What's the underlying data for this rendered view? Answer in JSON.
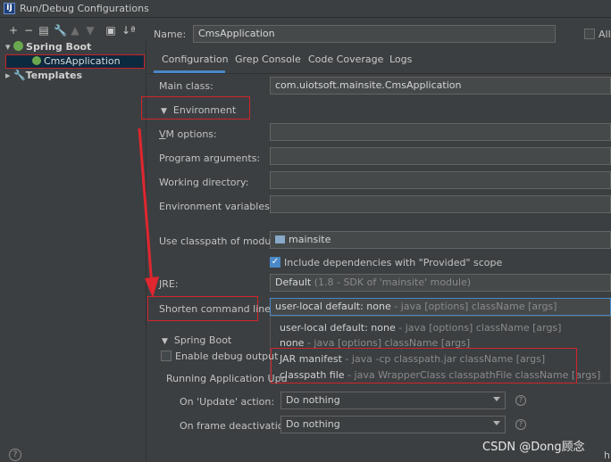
{
  "window": {
    "title": "Run/Debug Configurations",
    "app_icon": "IJ"
  },
  "toolbar": {
    "icons": [
      "plus-icon",
      "minus-icon",
      "copy-icon",
      "wrench-icon",
      "up-icon",
      "down-icon",
      "folder-icon",
      "sort-icon"
    ]
  },
  "tree": {
    "groups": [
      {
        "label": "Spring Boot",
        "children": [
          {
            "label": "CmsApplication"
          }
        ]
      },
      {
        "label": "Templates"
      }
    ]
  },
  "header": {
    "name_label": "Name:",
    "name_value": "CmsApplication",
    "allow_label": "Allo"
  },
  "tabs": [
    "Configuration",
    "Grep Console",
    "Code Coverage",
    "Logs"
  ],
  "form": {
    "main_class_label": "Main class:",
    "main_class_value": "com.uiotsoft.mainsite.CmsApplication",
    "environment_label": "Environment",
    "vm_options_label": "VM options:",
    "program_args_label": "Program arguments:",
    "working_dir_label": "Working directory:",
    "env_vars_label": "Environment variables:",
    "classpath_label": "Use classpath of module:",
    "classpath_value": "mainsite",
    "include_deps_label": "Include dependencies with \"Provided\" scope",
    "jre_label": "JRE:",
    "jre_value": "Default",
    "jre_hint": "(1.8 - SDK of 'mainsite' module)",
    "shorten_label": "Shorten command line:",
    "shorten_value": "user-local default: none",
    "shorten_hint": "- java [options] className [args]"
  },
  "dropdown": {
    "options": [
      {
        "main": "user-local default: none",
        "hint": "- java [options] className [args]"
      },
      {
        "main": "none",
        "hint": "- java [options] className [args]"
      },
      {
        "main": "JAR manifest",
        "hint": "- java -cp classpath.jar className [args]"
      },
      {
        "main": "classpath file",
        "hint": "- java WrapperClass classpathFile className [args]"
      }
    ]
  },
  "spring": {
    "section_label": "Spring Boot",
    "debug_output_label": "Enable debug output",
    "running_label": "Running Application Upd",
    "on_update_label": "On 'Update' action:",
    "on_update_value": "Do nothing",
    "on_frame_label": "On frame deactivation:",
    "on_frame_value": "Do nothing"
  },
  "watermark": "CSDN @Dong顾念",
  "footer": {
    "help": "?",
    "edge_char": "h"
  },
  "colors": {
    "accent": "#4a88c7",
    "annotation_red": "#d0242c",
    "spring_green": "#6aa84f"
  }
}
